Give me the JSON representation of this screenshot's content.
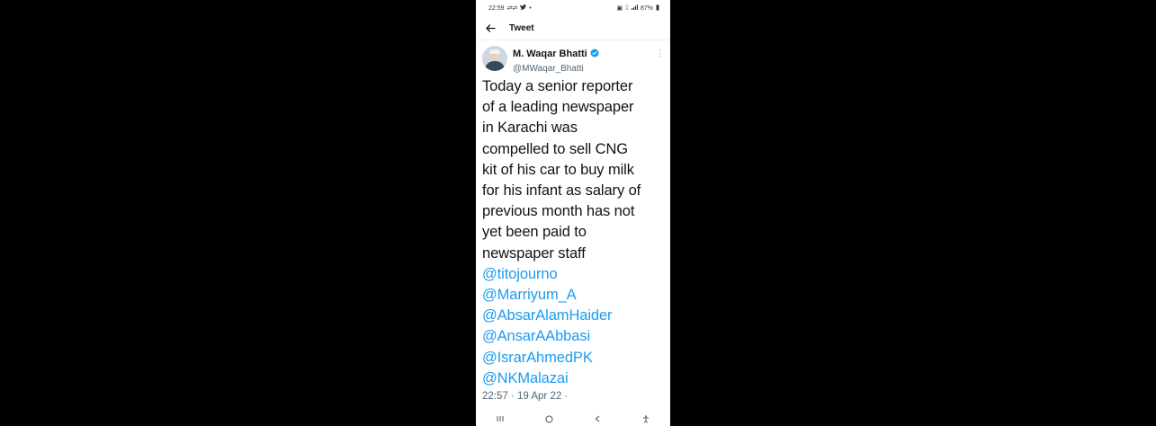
{
  "status_bar": {
    "time": "22:59",
    "battery": "87%"
  },
  "app_bar": {
    "title": "Tweet"
  },
  "author": {
    "display_name": "M. Waqar Bhatti",
    "handle": "@MWaqar_Bhatti"
  },
  "tweet": {
    "lines": [
      "Today a senior reporter",
      "of a leading newspaper",
      "in Karachi was",
      "compelled to sell CNG",
      "kit of his car to buy milk",
      "for his infant as salary of",
      "previous month has not",
      "yet been paid to",
      "newspaper staff"
    ],
    "mentions": [
      "@titojourno",
      "@Marriyum_A",
      "@AbsarAlamHaider",
      "@AnsarAAbbasi",
      "@IsrarAhmedPK",
      "@NKMalazai"
    ],
    "timestamp": "22:57 · 19 Apr 22 ·"
  },
  "icons": {
    "back": "arrow-left-icon",
    "verified": "verified-badge-icon",
    "more": "more-vertical-icon",
    "nav_recents": "recents-icon",
    "nav_home": "home-icon",
    "nav_back": "chevron-left-icon",
    "nav_accessibility": "accessibility-icon"
  },
  "colors": {
    "link": "#1d9bf0",
    "text": "#0f1419",
    "secondary": "#536471",
    "background": "#000000"
  }
}
